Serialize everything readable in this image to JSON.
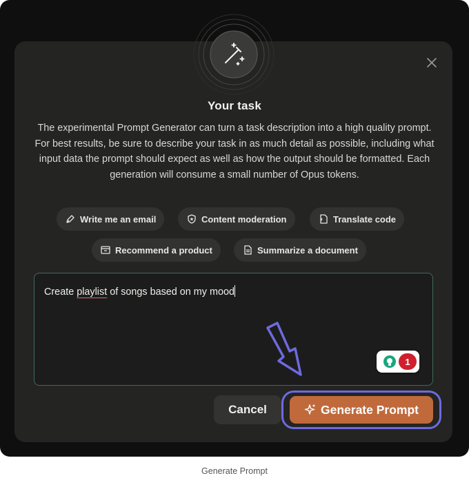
{
  "dialog": {
    "title": "Your task",
    "description": "The experimental Prompt Generator can turn a task description into a high quality prompt. For best results, be sure to describe your task in as much detail as possible, including what input data the prompt should expect as well as how the output should be formatted. Each generation will consume a small number of Opus tokens.",
    "header_icon": "magic-wand-icon",
    "close_icon": "close-icon"
  },
  "suggestions": [
    {
      "label": "Write me an email",
      "icon": "pen-icon"
    },
    {
      "label": "Content moderation",
      "icon": "shield-star-icon"
    },
    {
      "label": "Translate code",
      "icon": "code-file-icon"
    },
    {
      "label": "Recommend a product",
      "icon": "box-icon"
    },
    {
      "label": "Summarize a document",
      "icon": "document-icon"
    }
  ],
  "task_input": {
    "before": "Create ",
    "misspelled": "playlist",
    "after": " of songs based on my mood"
  },
  "grammarly": {
    "issue_count": "1"
  },
  "buttons": {
    "cancel": "Cancel",
    "generate": "Generate Prompt"
  },
  "caption": "Generate Prompt",
  "colors": {
    "accent": "#c06a3c",
    "highlight": "#6e6ae0",
    "input_border": "#3f6b5c"
  }
}
